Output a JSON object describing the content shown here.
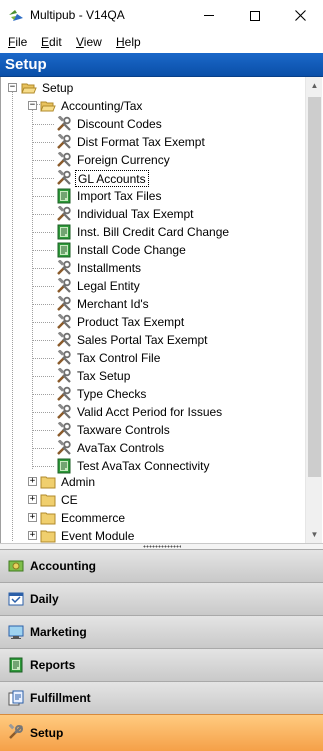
{
  "window": {
    "title": "Multipub - V14QA",
    "minimize_symbol": "—",
    "maximize_symbol": "☐",
    "close_symbol": "✕"
  },
  "menu": {
    "items": [
      {
        "ul": "F",
        "rest": "ile"
      },
      {
        "ul": "E",
        "rest": "dit"
      },
      {
        "ul": "V",
        "rest": "iew"
      },
      {
        "ul": "H",
        "rest": "elp"
      }
    ]
  },
  "section": {
    "title": "Setup"
  },
  "tree": {
    "root": "Setup",
    "accounting_folder": "Accounting/Tax",
    "accounting_items": [
      {
        "label": "Discount Codes",
        "icon": "tools-icon"
      },
      {
        "label": "Dist Format Tax Exempt",
        "icon": "tools-icon"
      },
      {
        "label": "Foreign Currency",
        "icon": "tools-icon"
      },
      {
        "label": "GL Accounts",
        "icon": "tools-icon"
      },
      {
        "label": "Import Tax Files",
        "icon": "green-form-icon"
      },
      {
        "label": "Individual Tax Exempt",
        "icon": "tools-icon"
      },
      {
        "label": "Inst. Bill Credit Card Change",
        "icon": "green-form-icon"
      },
      {
        "label": "Install Code Change",
        "icon": "green-form-icon"
      },
      {
        "label": "Installments",
        "icon": "tools-icon"
      },
      {
        "label": "Legal Entity",
        "icon": "tools-icon"
      },
      {
        "label": "Merchant Id's",
        "icon": "tools-icon"
      },
      {
        "label": "Product Tax Exempt",
        "icon": "tools-icon"
      },
      {
        "label": "Sales Portal Tax Exempt",
        "icon": "tools-icon"
      },
      {
        "label": "Tax Control File",
        "icon": "tools-icon"
      },
      {
        "label": "Tax Setup",
        "icon": "tools-icon"
      },
      {
        "label": "Type Checks",
        "icon": "tools-icon"
      },
      {
        "label": "Valid Acct Period for Issues",
        "icon": "tools-icon"
      },
      {
        "label": "Taxware Controls",
        "icon": "tools-icon"
      },
      {
        "label": "AvaTax Controls",
        "icon": "tools-icon"
      },
      {
        "label": "Test AvaTax Connectivity",
        "icon": "green-form-icon"
      }
    ],
    "selected_index": 3,
    "collapsed_folders": [
      "Admin",
      "CE",
      "Ecommerce",
      "Event Module"
    ]
  },
  "nav": {
    "buttons": [
      {
        "label": "Accounting",
        "icon": "accounting-icon"
      },
      {
        "label": "Daily",
        "icon": "daily-icon"
      },
      {
        "label": "Marketing",
        "icon": "marketing-icon"
      },
      {
        "label": "Reports",
        "icon": "reports-icon"
      },
      {
        "label": "Fulfillment",
        "icon": "fulfillment-icon"
      },
      {
        "label": "Setup",
        "icon": "setup-icon"
      }
    ],
    "active": "Setup"
  },
  "colors": {
    "header_blue": "#0a4fa8",
    "active_orange": "#f5a048",
    "nav_gray": "#d4d4d4"
  }
}
